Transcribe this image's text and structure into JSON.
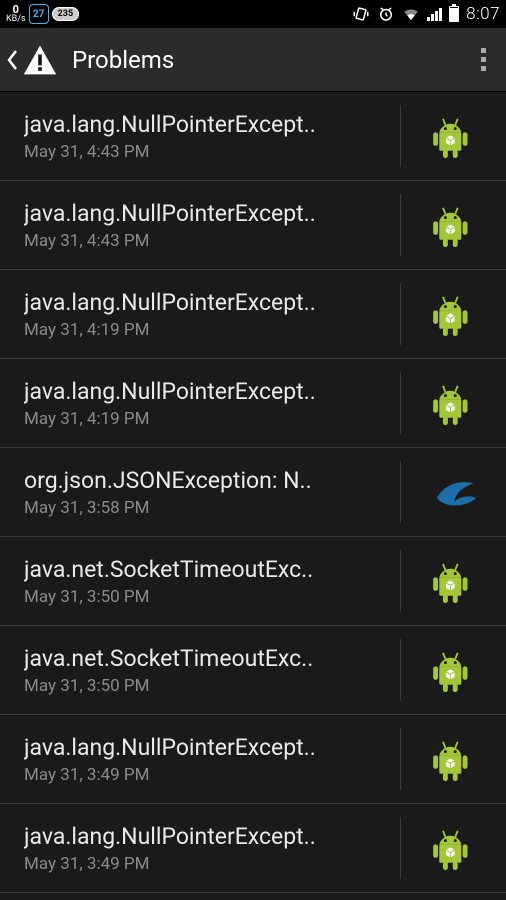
{
  "status": {
    "kbs_value": "0",
    "kbs_label": "KB/s",
    "badge1": "27",
    "badge2": "235",
    "clock": "8:07"
  },
  "actionbar": {
    "title": "Problems"
  },
  "items": [
    {
      "title": "java.lang.NullPointerExcept..",
      "time": "May 31, 4:43 PM",
      "icon": "android"
    },
    {
      "title": "java.lang.NullPointerExcept..",
      "time": "May 31, 4:43 PM",
      "icon": "android"
    },
    {
      "title": "java.lang.NullPointerExcept..",
      "time": "May 31, 4:19 PM",
      "icon": "android"
    },
    {
      "title": "java.lang.NullPointerExcept..",
      "time": "May 31, 4:19 PM",
      "icon": "android"
    },
    {
      "title": "org.json.JSONException: N..",
      "time": "May 31, 3:58 PM",
      "icon": "swoosh"
    },
    {
      "title": "java.net.SocketTimeoutExc..",
      "time": "May 31, 3:50 PM",
      "icon": "android"
    },
    {
      "title": "java.net.SocketTimeoutExc..",
      "time": "May 31, 3:50 PM",
      "icon": "android"
    },
    {
      "title": "java.lang.NullPointerExcept..",
      "time": "May 31, 3:49 PM",
      "icon": "android"
    },
    {
      "title": "java.lang.NullPointerExcept..",
      "time": "May 31, 3:49 PM",
      "icon": "android"
    }
  ]
}
